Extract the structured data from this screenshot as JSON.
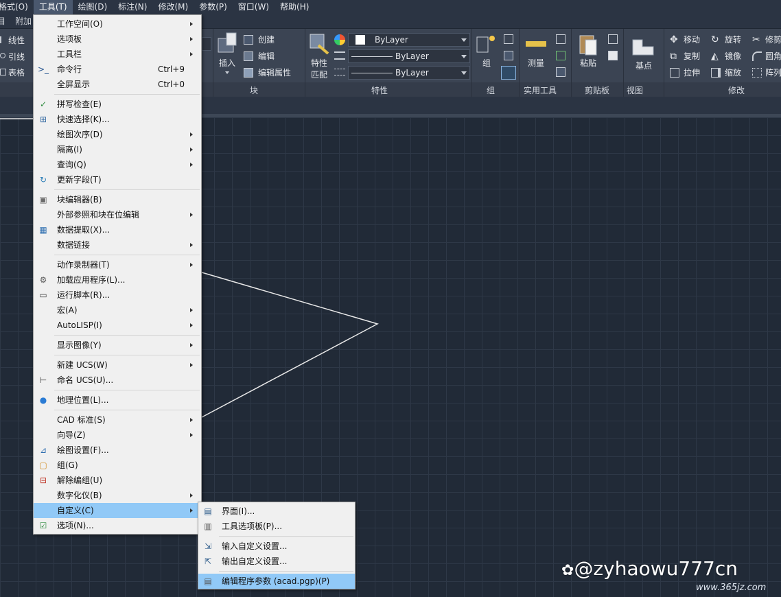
{
  "menubar": {
    "items": [
      "格式(O)",
      "工具(T)",
      "绘图(D)",
      "标注(N)",
      "修改(M)",
      "参数(P)",
      "窗口(W)",
      "帮助(H)"
    ]
  },
  "tabrow": {
    "item_left": "目",
    "item_addon": "附加"
  },
  "ribbon": {
    "annotation": {
      "linear": "线性",
      "leader": "引线",
      "table": "表格"
    },
    "block": {
      "insert": "插入",
      "create": "创建",
      "edit": "编辑",
      "edit_attr": "编辑属性",
      "title": "块"
    },
    "properties": {
      "match_line1": "特性",
      "match_line2": "匹配",
      "color": "ByLayer",
      "linetype": "ByLayer",
      "lineweight": "ByLayer",
      "title": "特性"
    },
    "group": {
      "label": "组",
      "title": "组"
    },
    "utilities": {
      "measure": "测量",
      "title": "实用工具"
    },
    "clipboard": {
      "paste": "粘贴",
      "title": "剪贴板"
    },
    "view": {
      "base": "基点",
      "title": "视图"
    },
    "modify": {
      "move": "移动",
      "rotate": "旋转",
      "trim": "修剪",
      "copy": "复制",
      "mirror": "镜像",
      "fillet": "圆角",
      "stretch": "拉伸",
      "scale": "缩放",
      "array": "阵列",
      "title": "修改"
    }
  },
  "tools_menu": {
    "items": [
      {
        "label": "工作空间(O)",
        "acc": "",
        "sub": true,
        "icon": ""
      },
      {
        "label": "选项板",
        "acc": "",
        "sub": true,
        "icon": ""
      },
      {
        "label": "工具栏",
        "acc": "",
        "sub": true,
        "icon": ""
      },
      {
        "label": "命令行",
        "acc": "Ctrl+9",
        "sub": false,
        "icon": "command-line-icon"
      },
      {
        "label": "全屏显示",
        "acc": "Ctrl+0",
        "sub": false,
        "icon": ""
      },
      {
        "label": "拼写检查(E)",
        "acc": "",
        "sub": false,
        "icon": "spell-check-icon"
      },
      {
        "label": "快速选择(K)...",
        "acc": "",
        "sub": false,
        "icon": "quick-select-icon"
      },
      {
        "label": "绘图次序(D)",
        "acc": "",
        "sub": true,
        "icon": ""
      },
      {
        "label": "隔离(I)",
        "acc": "",
        "sub": true,
        "icon": ""
      },
      {
        "label": "查询(Q)",
        "acc": "",
        "sub": true,
        "icon": ""
      },
      {
        "label": "更新字段(T)",
        "acc": "",
        "sub": false,
        "icon": "update-field-icon"
      },
      {
        "label": "块编辑器(B)",
        "acc": "",
        "sub": false,
        "icon": "block-editor-icon"
      },
      {
        "label": "外部参照和块在位编辑",
        "acc": "",
        "sub": true,
        "icon": ""
      },
      {
        "label": "数据提取(X)...",
        "acc": "",
        "sub": false,
        "icon": "data-extraction-icon"
      },
      {
        "label": "数据链接",
        "acc": "",
        "sub": true,
        "icon": ""
      },
      {
        "label": "动作录制器(T)",
        "acc": "",
        "sub": true,
        "icon": ""
      },
      {
        "label": "加载应用程序(L)...",
        "acc": "",
        "sub": false,
        "icon": "load-application-icon"
      },
      {
        "label": "运行脚本(R)...",
        "acc": "",
        "sub": false,
        "icon": "run-script-icon"
      },
      {
        "label": "宏(A)",
        "acc": "",
        "sub": true,
        "icon": ""
      },
      {
        "label": "AutoLISP(I)",
        "acc": "",
        "sub": true,
        "icon": ""
      },
      {
        "label": "显示图像(Y)",
        "acc": "",
        "sub": true,
        "icon": ""
      },
      {
        "label": "新建 UCS(W)",
        "acc": "",
        "sub": true,
        "icon": ""
      },
      {
        "label": "命名 UCS(U)...",
        "acc": "",
        "sub": false,
        "icon": "named-ucs-icon"
      },
      {
        "label": "地理位置(L)...",
        "acc": "",
        "sub": false,
        "icon": "globe-icon"
      },
      {
        "label": "CAD 标准(S)",
        "acc": "",
        "sub": true,
        "icon": ""
      },
      {
        "label": "向导(Z)",
        "acc": "",
        "sub": true,
        "icon": ""
      },
      {
        "label": "绘图设置(F)...",
        "acc": "",
        "sub": false,
        "icon": "drafting-settings-icon"
      },
      {
        "label": "组(G)",
        "acc": "",
        "sub": false,
        "icon": "group-icon"
      },
      {
        "label": "解除编组(U)",
        "acc": "",
        "sub": false,
        "icon": "ungroup-icon"
      },
      {
        "label": "数字化仪(B)",
        "acc": "",
        "sub": true,
        "icon": ""
      },
      {
        "label": "自定义(C)",
        "acc": "",
        "sub": true,
        "icon": ""
      },
      {
        "label": "选项(N)...",
        "acc": "",
        "sub": false,
        "icon": "options-check-icon"
      }
    ]
  },
  "customize_submenu": {
    "items": [
      {
        "label": "界面(I)...",
        "icon": "cui-icon"
      },
      {
        "label": "工具选项板(P)...",
        "icon": "tool-palettes-icon"
      },
      {
        "label": "输入自定义设置...",
        "icon": "import-cui-icon"
      },
      {
        "label": "输出自定义设置...",
        "icon": "export-cui-icon"
      },
      {
        "label": "编辑程序参数 (acad.pgp)(P)",
        "icon": "pgp-icon"
      }
    ]
  },
  "watermark": {
    "main": "@zyhaowu777cn",
    "site": "www.365jz.com"
  },
  "colors": {
    "highlight": "#91c9f7",
    "menubar_active": "#4a586e",
    "canvas": "#212a37"
  }
}
